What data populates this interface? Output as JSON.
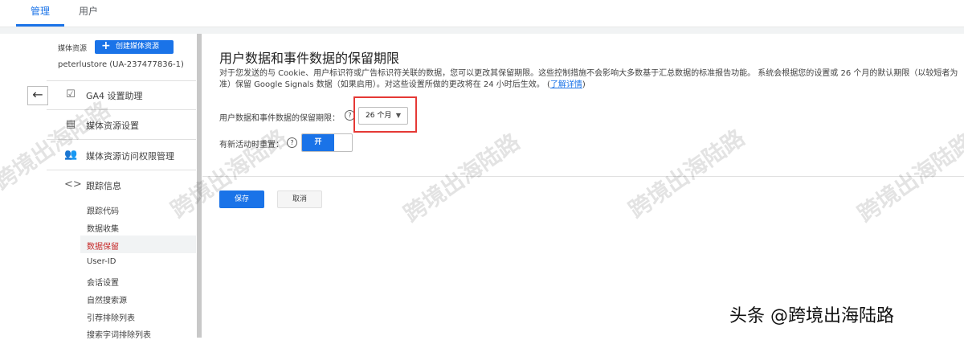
{
  "top_tabs": [
    {
      "label": "管理",
      "active": true
    },
    {
      "label": "用户",
      "active": false
    }
  ],
  "sidebar": {
    "property_label": "媒体资源",
    "create_button": "创建媒体资源",
    "property_id": "peterlustore (UA-237477836-1)",
    "items": [
      {
        "label": "GA4 设置助理",
        "icon": "checkbox-icon"
      },
      {
        "label": "媒体资源设置",
        "icon": "layout-icon"
      },
      {
        "label": "媒体资源访问权限管理",
        "icon": "people-icon"
      },
      {
        "label": "跟踪信息",
        "icon": "code-icon"
      }
    ],
    "subitems": [
      "跟踪代码",
      "数据收集",
      "数据保留",
      "User-ID",
      "会话设置",
      "自然搜索源",
      "引荐排除列表",
      "搜索字词排除列表"
    ],
    "active_subitem": "数据保留"
  },
  "main": {
    "title": "用户数据和事件数据的保留期限",
    "description": "对于您发送的与 Cookie、用户标识符或广告标识符关联的数据，您可以更改其保留期限。这些控制措施不会影响大多数基于汇总数据的标准报告功能。 系统会根据您的设置或 26 个月的默认期限（以较短者为准）保留 Google Signals 数据（如果启用）。对这些设置所做的更改将在 24 小时后生效。",
    "learn_more": "了解详情",
    "retention_label": "用户数据和事件数据的保留期限：",
    "retention_value": "26 个月",
    "reset_label": "有新活动时重置：",
    "toggle_label": "开",
    "toggle_on": true,
    "save_button": "保存",
    "cancel_button": "取消"
  },
  "watermark": "跨境出海陆路",
  "credit": "头条 @跨境出海陆路",
  "colors": {
    "accent": "#1a73e8",
    "highlight_box": "#e53935",
    "active_subitem": "#c62828"
  }
}
